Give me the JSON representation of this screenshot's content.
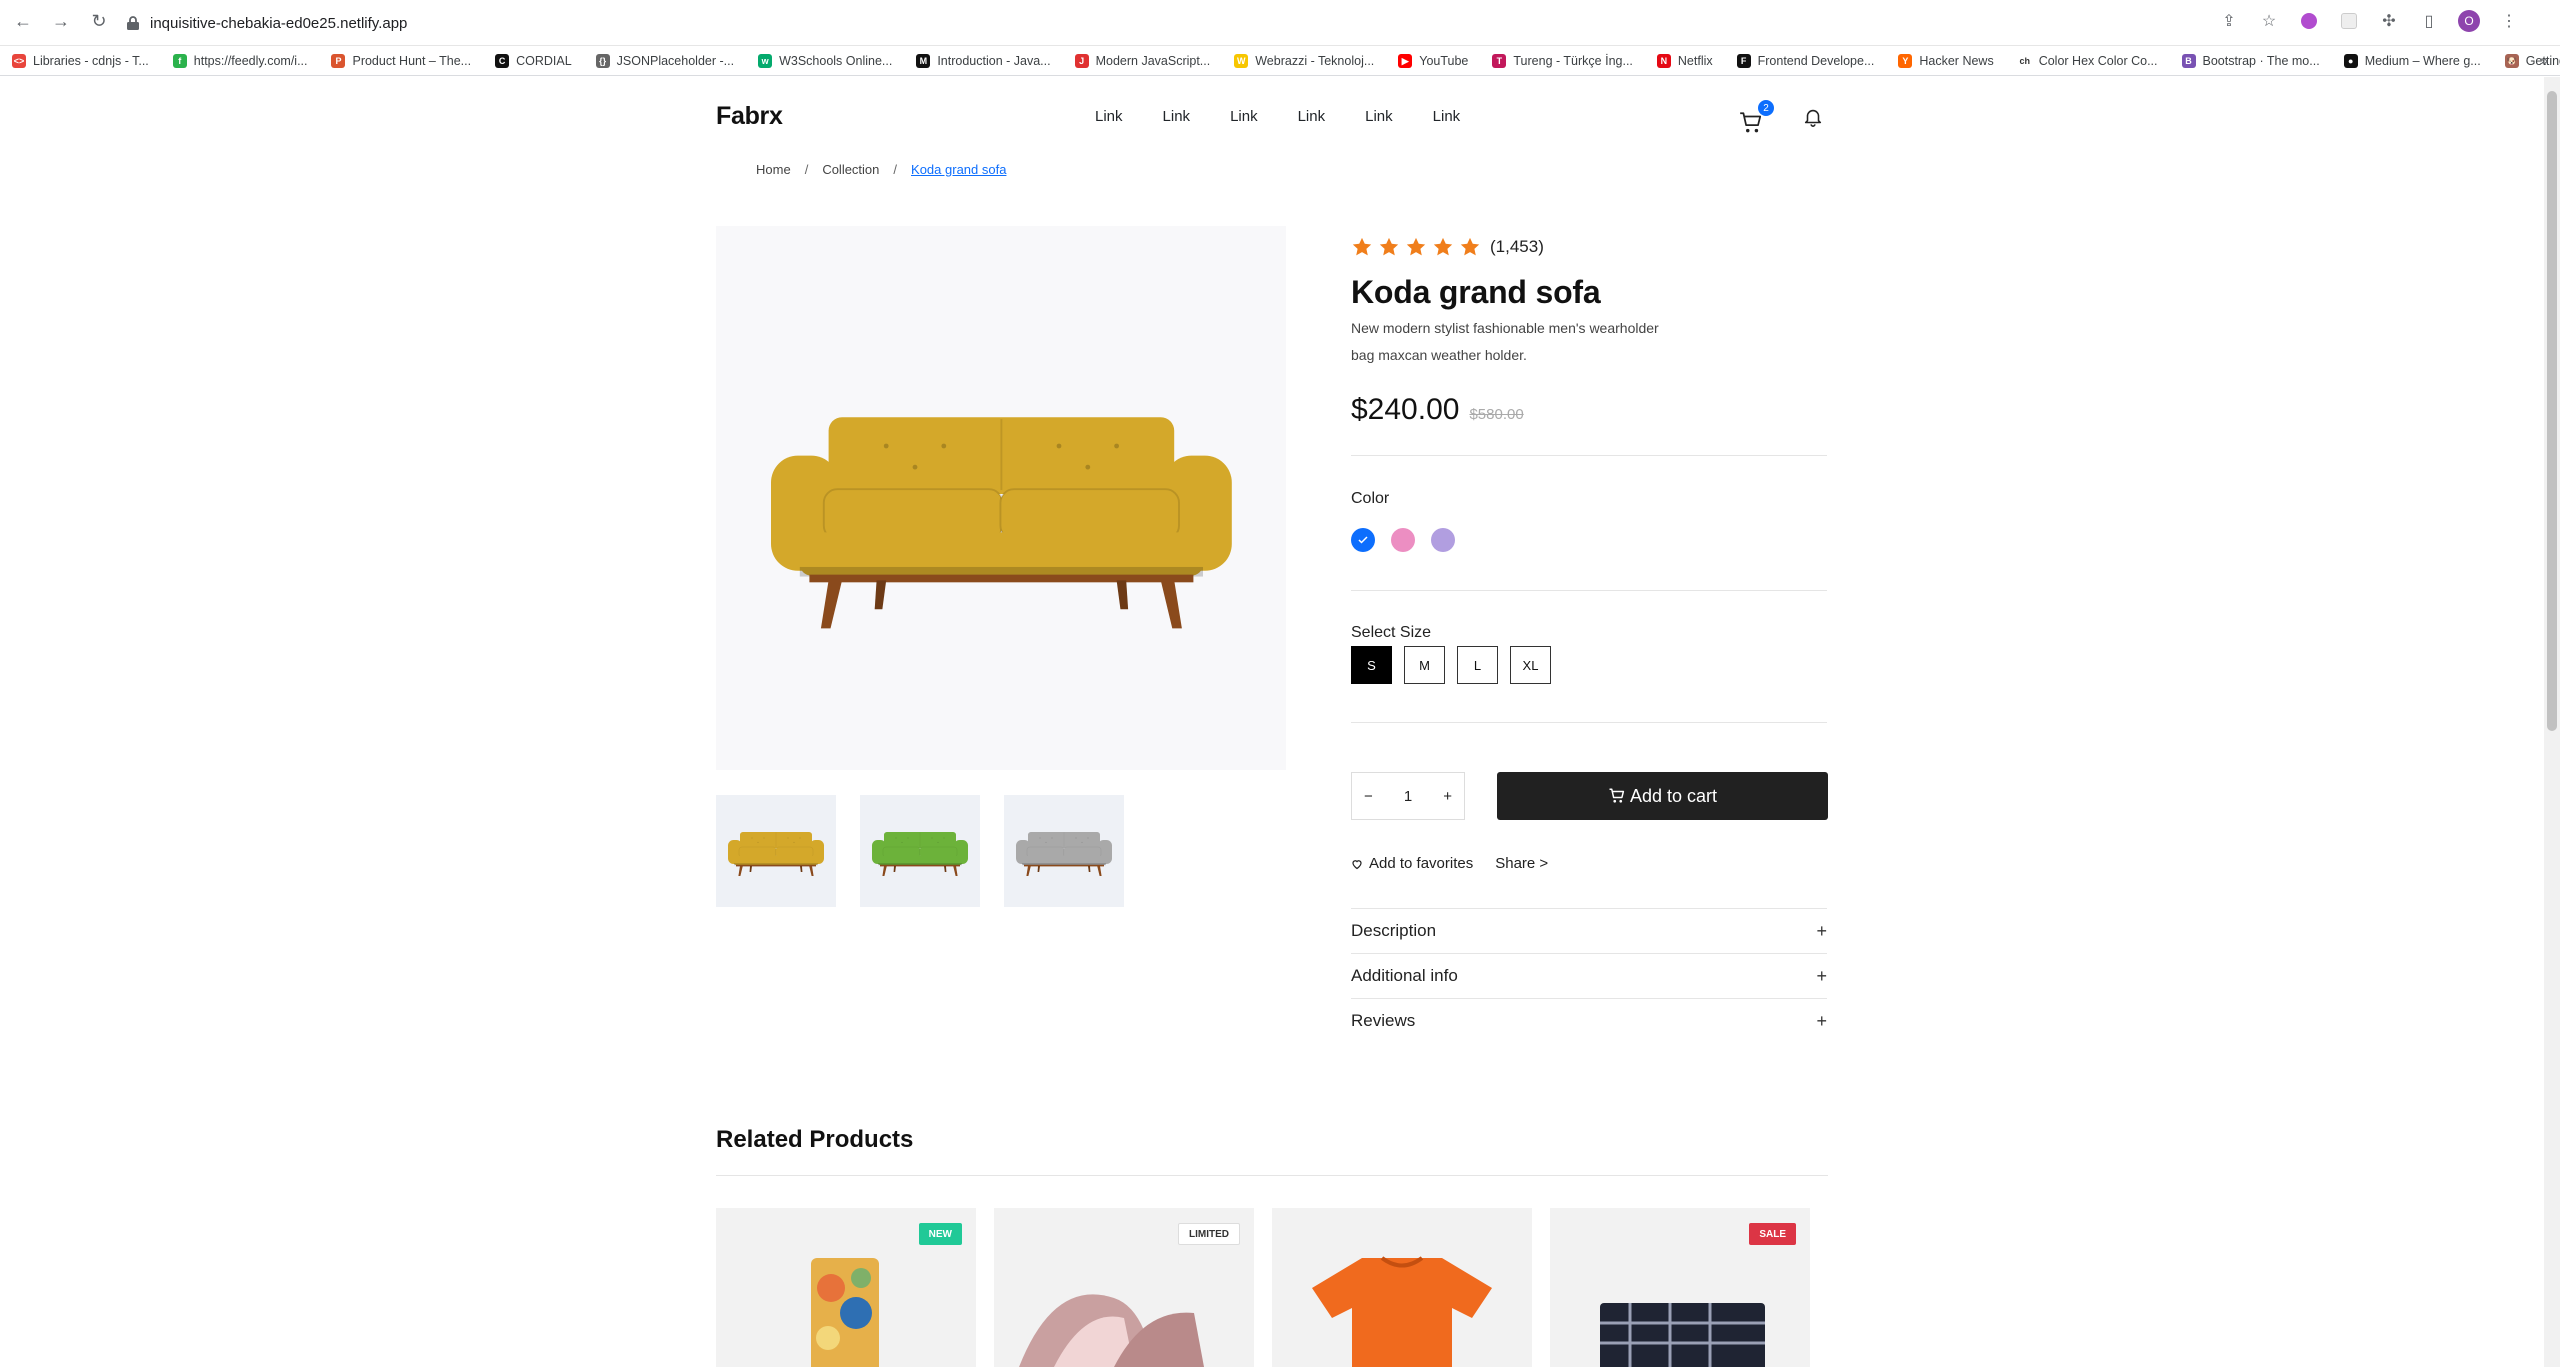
{
  "browser": {
    "url": "inquisitive-chebakia-ed0e25.netlify.app",
    "profile_initial": "O",
    "bookmarks": [
      {
        "label": "Libraries - cdnjs - T...",
        "color": "#e8453c",
        "glyph": "<>"
      },
      {
        "label": "https://feedly.com/i...",
        "color": "#2bb24c",
        "glyph": "f"
      },
      {
        "label": "Product Hunt – The...",
        "color": "#da552f",
        "glyph": "P"
      },
      {
        "label": "CORDIAL",
        "color": "#111111",
        "glyph": "C"
      },
      {
        "label": "JSONPlaceholder -...",
        "color": "#666666",
        "glyph": "{}"
      },
      {
        "label": "W3Schools Online...",
        "color": "#04aa6d",
        "glyph": "w"
      },
      {
        "label": "Introduction - Java...",
        "color": "#111111",
        "glyph": "M"
      },
      {
        "label": "Modern JavaScript...",
        "color": "#e03131",
        "glyph": "J"
      },
      {
        "label": "Webrazzi - Teknoloj...",
        "color": "#f7c600",
        "glyph": "W"
      },
      {
        "label": "YouTube",
        "color": "#ff0000",
        "glyph": "▶"
      },
      {
        "label": "Tureng - Türkçe İng...",
        "color": "#c2185b",
        "glyph": "T"
      },
      {
        "label": "Netflix",
        "color": "#e50914",
        "glyph": "N"
      },
      {
        "label": "Frontend Develope...",
        "color": "#111111",
        "glyph": "F"
      },
      {
        "label": "Hacker News",
        "color": "#ff6600",
        "glyph": "Y"
      },
      {
        "label": "Color Hex Color Co...",
        "color": "#ffffff",
        "glyph": "ch"
      },
      {
        "label": "Bootstrap · The mo...",
        "color": "#7952b3",
        "glyph": "B"
      },
      {
        "label": "Medium – Where g...",
        "color": "#111111",
        "glyph": "●"
      },
      {
        "label": "Getting Started – Pug",
        "color": "#a86454",
        "glyph": "🐶"
      }
    ]
  },
  "header": {
    "logo": "Fabrx",
    "nav": [
      "Link",
      "Link",
      "Link",
      "Link",
      "Link",
      "Link"
    ],
    "cart_count": "2"
  },
  "breadcrumb": {
    "items": [
      "Home",
      "Collection"
    ],
    "separator": "/",
    "current": "Koda grand sofa"
  },
  "product": {
    "rating_stars": 5,
    "rating_count": "(1,453)",
    "title": "Koda grand sofa",
    "description_line1": "New modern stylist fashionable men's wearholder",
    "description_line2": "bag maxcan weather holder.",
    "price": "$240.00",
    "old_price": "$580.00",
    "color_label": "Color",
    "colors": [
      "#0d6efd",
      "#ec8ec2",
      "#b19ee0"
    ],
    "selected_color_index": 0,
    "size_label": "Select Size",
    "sizes": [
      "S",
      "M",
      "L",
      "XL"
    ],
    "selected_size": "S",
    "quantity": "1",
    "qty_minus": "−",
    "qty_plus": "+",
    "add_to_cart": "Add to cart",
    "favorites": "Add to favorites",
    "share": "Share >",
    "thumbnails": [
      "mustard",
      "green",
      "gray"
    ],
    "sofa_colors": {
      "mustard": "#d4a82a",
      "green": "#6cb23a",
      "gray": "#a9a9a9"
    }
  },
  "accordion": [
    {
      "label": "Description",
      "icon": "+"
    },
    {
      "label": "Additional info",
      "icon": "+"
    },
    {
      "label": "Reviews",
      "icon": "+"
    }
  ],
  "related": {
    "title": "Related Products",
    "cards": [
      {
        "badge": "NEW",
        "badge_bg": "#20c997",
        "badge_fg": "#ffffff"
      },
      {
        "badge": "LIMITED",
        "badge_bg": "#ffffff",
        "badge_fg": "#333333"
      },
      {
        "badge": "",
        "badge_bg": "",
        "badge_fg": ""
      },
      {
        "badge": "SALE",
        "badge_bg": "#dc3545",
        "badge_fg": "#ffffff"
      }
    ]
  }
}
